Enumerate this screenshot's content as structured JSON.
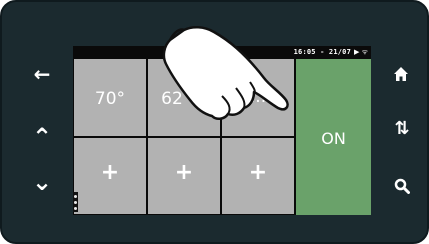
{
  "nav_left": {
    "back_icon": "←",
    "up_icon": "⌃",
    "down_icon": "⌄"
  },
  "nav_right": {
    "home_icon": "home-icon",
    "sort_icon": "⇅",
    "search_icon": "search-icon"
  },
  "status": {
    "time_date": "16:05 - 21/07",
    "icons": "▶ ᯤ"
  },
  "tiles": [
    {
      "label": "70°"
    },
    {
      "label": "62"
    },
    {
      "label": "..."
    },
    {
      "label": "+"
    },
    {
      "label": "+"
    },
    {
      "label": "+"
    }
  ],
  "on_tile": {
    "label": "ON"
  },
  "colors": {
    "bezel": "#1b2a2f",
    "tile": "#b2b2b2",
    "on_tile": "#6aa26a"
  }
}
